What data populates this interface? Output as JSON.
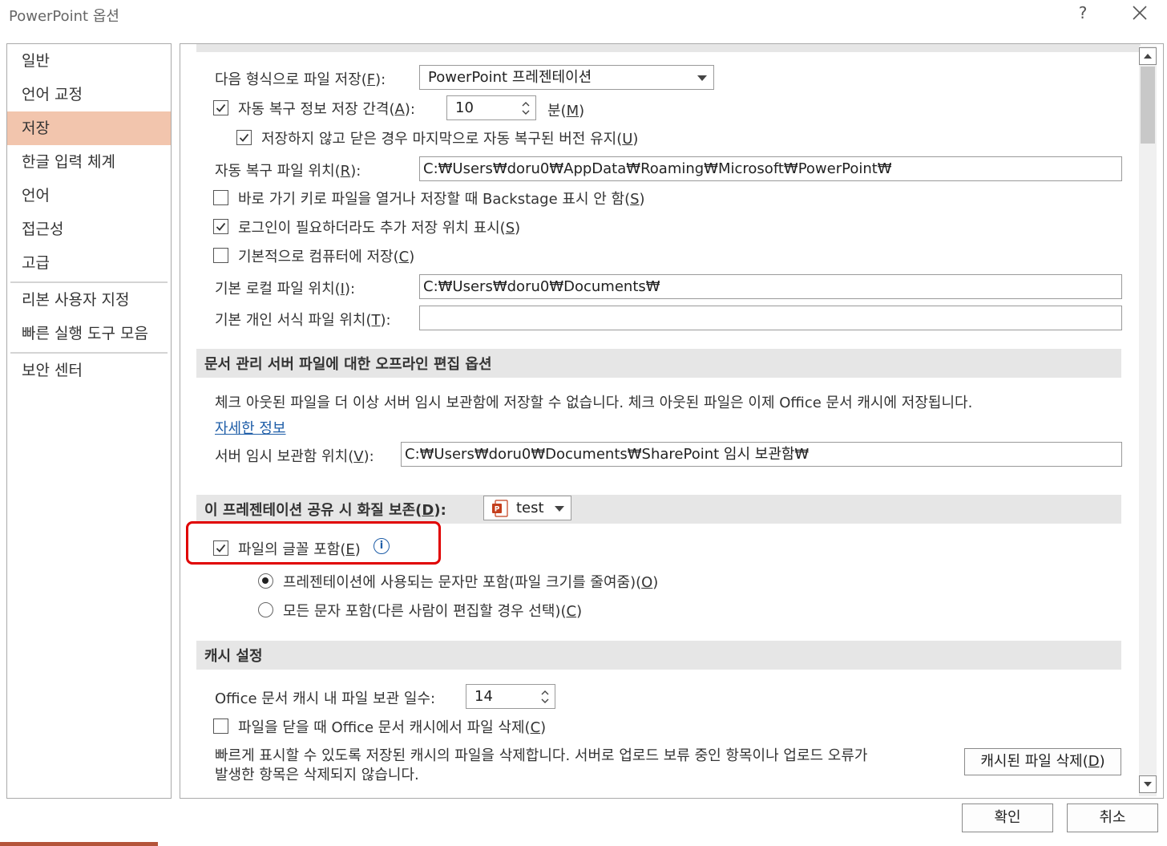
{
  "window": {
    "title": "PowerPoint 옵션",
    "help": "?"
  },
  "sidebar": {
    "items": [
      {
        "label": "일반"
      },
      {
        "label": "언어 교정"
      },
      {
        "label": "저장",
        "active": true
      },
      {
        "label": "한글 입력 체계"
      },
      {
        "label": "언어"
      },
      {
        "label": "접근성"
      },
      {
        "label": "고급"
      },
      {
        "label": "리본 사용자 지정"
      },
      {
        "label": "빠른 실행 도구 모음"
      },
      {
        "label": "보안 센터"
      }
    ]
  },
  "save": {
    "format_label": "다음 형식으로 파일 저장(",
    "format_key": "F",
    "format_suffix": "):",
    "format_value": "PowerPoint 프레젠테이션",
    "autorecover_label": "자동 복구 정보 저장 간격(",
    "autorecover_key": "A",
    "autorecover_suffix": "):",
    "autorecover_checked": true,
    "autorecover_minutes": "10",
    "minutes_label": "분(",
    "minutes_key": "M",
    "minutes_suffix": ")",
    "keep_last_label": "저장하지 않고 닫은 경우 마지막으로 자동 복구된 버전 유지(",
    "keep_last_key": "U",
    "keep_last_suffix": ")",
    "keep_last_checked": true,
    "autorecover_location_label": "자동 복구 파일 위치(",
    "autorecover_location_key": "R",
    "autorecover_location_suffix": "):",
    "autorecover_location_value": "C:₩Users₩doru0₩AppData₩Roaming₩Microsoft₩PowerPoint₩",
    "backstage_label": "바로 가기 키로 파일을 열거나 저장할 때 Backstage 표시 안 함(",
    "backstage_key": "S",
    "backstage_suffix": ")",
    "backstage_checked": false,
    "additional_places_label": "로그인이 필요하더라도 추가 저장 위치 표시(",
    "additional_places_key": "S",
    "additional_places_suffix": ")",
    "additional_places_checked": true,
    "save_to_computer_label": "기본적으로 컴퓨터에 저장(",
    "save_to_computer_key": "C",
    "save_to_computer_suffix": ")",
    "save_to_computer_checked": false,
    "local_location_label": "기본 로컬 파일 위치(",
    "local_location_key": "I",
    "local_location_suffix": "):",
    "local_location_value": "C:₩Users₩doru0₩Documents₩",
    "template_location_label": "기본 개인 서식 파일 위치(",
    "template_location_key": "T",
    "template_location_suffix": "):",
    "template_location_value": ""
  },
  "offline": {
    "title": "문서 관리 서버 파일에 대한 오프라인 편집 옵션",
    "description": "체크 아웃된 파일을 더 이상 서버 임시 보관함에 저장할 수 없습니다. 체크 아웃된 파일은 이제 Office 문서 캐시에 저장됩니다.",
    "learn_more": "자세한 정보",
    "drafts_label": "서버 임시 보관함 위치(",
    "drafts_key": "V",
    "drafts_suffix": "):",
    "drafts_value": "C:₩Users₩doru0₩Documents₩SharePoint 임시 보관함₩"
  },
  "fidelity": {
    "title": "이 프레젠테이션 공유 시 화질 보존(",
    "title_key": "D",
    "title_suffix": "):",
    "presentation": "test",
    "embed_label": "파일의 글꼴 포함(",
    "embed_key": "E",
    "embed_suffix": ")",
    "embed_checked": true,
    "info": "i",
    "option1_label": "프레젠테이션에 사용되는 문자만 포함(파일 크기를 줄여줌)(",
    "option1_key": "O",
    "option1_suffix": ")",
    "option1_selected": true,
    "option2_label": "모든 문자 포함(다른 사람이 편집할 경우 선택)(",
    "option2_key": "C",
    "option2_suffix": ")",
    "option2_selected": false
  },
  "cache": {
    "title": "캐시 설정",
    "days_label": "Office 문서 캐시 내 파일 보관 일수:",
    "days_value": "14",
    "delete_on_close_label": "파일을 닫을 때 Office 문서 캐시에서 파일 삭제(",
    "delete_on_close_key": "C",
    "delete_on_close_suffix": ")",
    "delete_on_close_checked": false,
    "description_line1": "빠르게 표시할 수 있도록 저장된 캐시의 파일을 삭제합니다. 서버로 업로드 보류 중인 항목이나 업로드 오류가",
    "description_line2": "발생한 항목은 삭제되지 않습니다.",
    "delete_button": "캐시된 파일 삭제(",
    "delete_button_key": "D",
    "delete_button_suffix": ")"
  },
  "footer": {
    "ok": "확인",
    "cancel": "취소"
  },
  "colors": {
    "accent_active": "#f2c5ad",
    "highlight": "#e00000",
    "link": "#1f5ea8"
  }
}
